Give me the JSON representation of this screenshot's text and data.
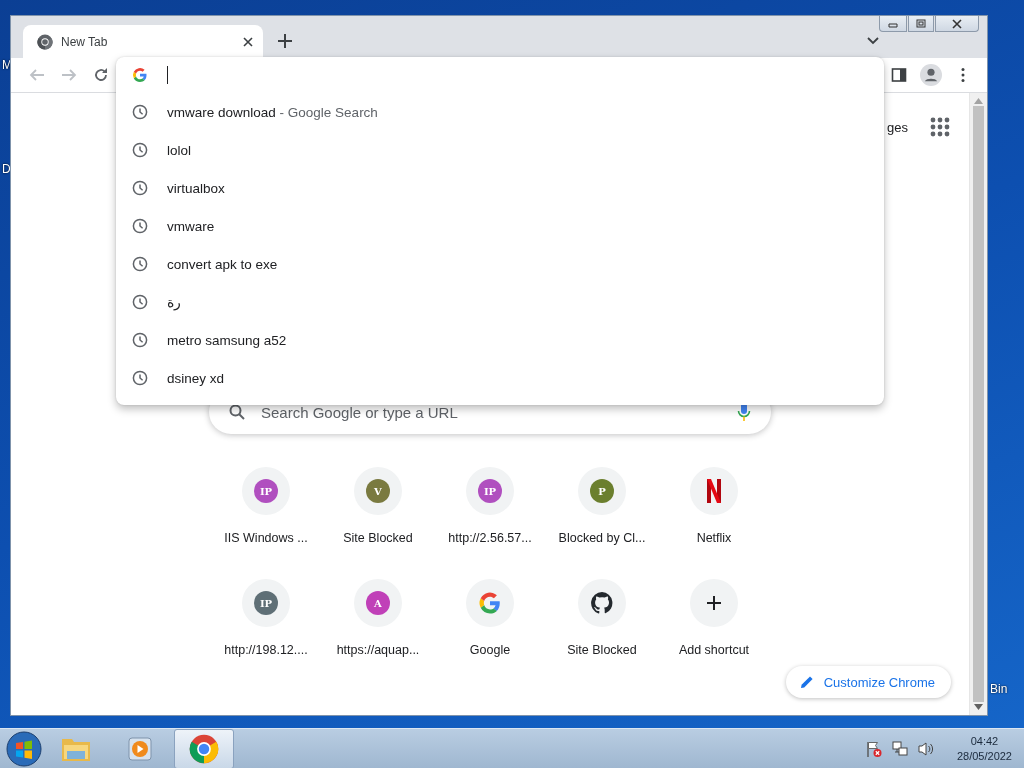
{
  "desktop_labels": [
    {
      "text": "M"
    },
    {
      "text": "D"
    },
    {
      "text": "Bin"
    }
  ],
  "window": {
    "tabs": [
      {
        "title": "New Tab",
        "selected": true
      }
    ]
  },
  "suggestions": [
    {
      "text": "vmware download",
      "detail": "- Google Search"
    },
    {
      "text": "lolol"
    },
    {
      "text": "virtualbox"
    },
    {
      "text": "vmware"
    },
    {
      "text": "convert apk to exe"
    },
    {
      "text": "رة"
    },
    {
      "text": "metro samsung a52"
    },
    {
      "text": "dsiney xd"
    }
  ],
  "header_links": [
    {
      "text": "ges"
    }
  ],
  "search": {
    "placeholder": "Search Google or type a URL"
  },
  "shortcuts": [
    {
      "label": "IIS Windows ...",
      "kind": "letter",
      "letter": "IP",
      "color": "#b04fbf"
    },
    {
      "label": "Site Blocked",
      "kind": "letter",
      "letter": "V",
      "color": "#7a7a40"
    },
    {
      "label": "http://2.56.57...",
      "kind": "letter",
      "letter": "IP",
      "color": "#b04fbf"
    },
    {
      "label": "Blocked by Cl...",
      "kind": "letter",
      "letter": "P",
      "color": "#6b7f2e"
    },
    {
      "label": "Netflix",
      "kind": "netflix"
    },
    {
      "label": "http://198.12....",
      "kind": "letter",
      "letter": "IP",
      "color": "#5f6f76"
    },
    {
      "label": "https://aquap...",
      "kind": "letter",
      "letter": "A",
      "color": "#c040b8"
    },
    {
      "label": "Google",
      "kind": "google"
    },
    {
      "label": "Site Blocked",
      "kind": "github"
    },
    {
      "label": "Add shortcut",
      "kind": "add"
    }
  ],
  "customize_button": "Customize Chrome",
  "taskbar": {
    "apps": [
      {
        "kind": "explorer",
        "selected": false
      },
      {
        "kind": "media",
        "selected": false
      },
      {
        "kind": "chrome",
        "selected": true
      }
    ],
    "clock": {
      "time": "04:42",
      "date": "28/05/2022"
    }
  }
}
